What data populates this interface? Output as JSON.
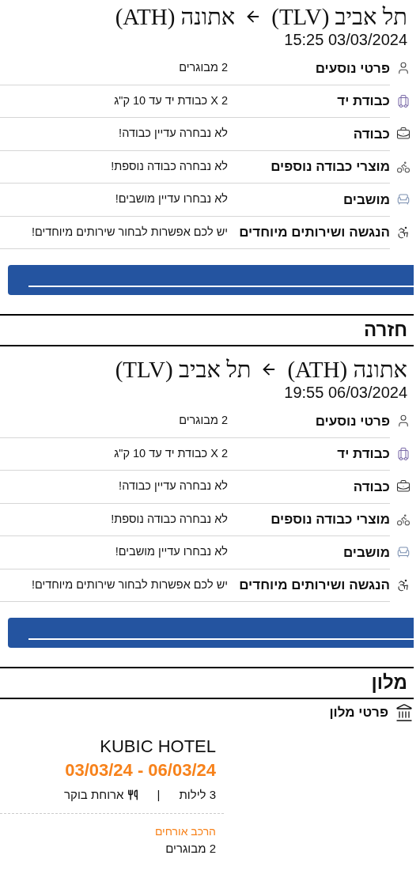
{
  "flights": [
    {
      "origin": "תל אביב (TLV)",
      "destination": "אתונה (ATH)",
      "datetime": "15:25 03/03/2024",
      "rows": [
        {
          "label": "פרטי נוסעים",
          "value": "2 מבוגרים"
        },
        {
          "label": "כבודת יד",
          "value": "2 X כבודת יד עד 10 ק\"ג"
        },
        {
          "label": "כבודה",
          "value": "לא נבחרה עדיין כבודה!"
        },
        {
          "label": "מוצרי כבודה נוספים",
          "value": "לא נבחרה כבודה נוספת!"
        },
        {
          "label": "מושבים",
          "value": "לא נבחרו עדיין מושבים!"
        },
        {
          "label": "הנגשה ושירותים מיוחדים",
          "value": "יש לכם אפשרות לבחור שירותים מיוחדים!"
        }
      ]
    },
    {
      "heading": "חזרה",
      "origin": "אתונה (ATH)",
      "destination": "תל אביב (TLV)",
      "datetime": "19:55 06/03/2024",
      "rows": [
        {
          "label": "פרטי נוסעים",
          "value": "2 מבוגרים"
        },
        {
          "label": "כבודת יד",
          "value": "2 X כבודת יד עד 10 ק\"ג"
        },
        {
          "label": "כבודה",
          "value": "לא נבחרה עדיין כבודה!"
        },
        {
          "label": "מוצרי כבודה נוספים",
          "value": "לא נבחרה כבודה נוספת!"
        },
        {
          "label": "מושבים",
          "value": "לא נבחרו עדיין מושבים!"
        },
        {
          "label": "הנגשה ושירותים מיוחדים",
          "value": "יש לכם אפשרות לבחור שירותים מיוחדים!"
        }
      ]
    }
  ],
  "hotel": {
    "heading": "מלון",
    "subheading": "פרטי מלון",
    "name": "KUBIC HOTEL",
    "dates": "03/03/24 - 06/03/24",
    "nights": "3 לילות",
    "separator": "|",
    "board": "ארוחת בוקר",
    "guests_label": "הרכב אורחים",
    "guests": "2 מבוגרים"
  }
}
